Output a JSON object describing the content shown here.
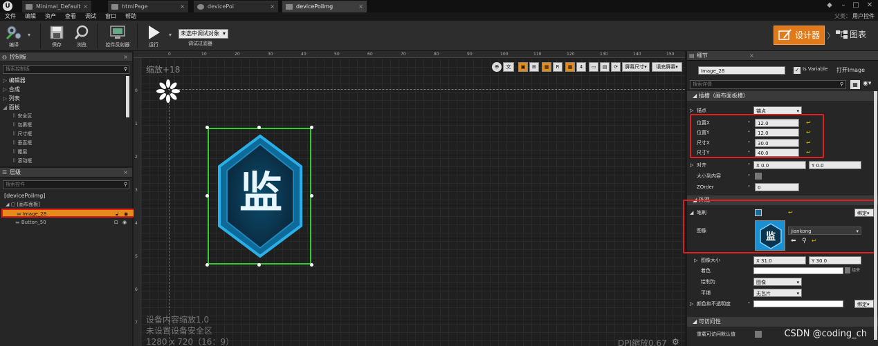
{
  "tabs": [
    {
      "label": "Minimal_Default"
    },
    {
      "label": "htmlPage"
    },
    {
      "label": "devicePoi"
    },
    {
      "label": "devicePoiImg"
    }
  ],
  "menu": {
    "items": [
      "文件",
      "编辑",
      "资产",
      "查看",
      "调试",
      "窗口",
      "帮助"
    ],
    "right": [
      "父类：",
      "用户控件"
    ]
  },
  "toolbar": {
    "compile": "编译",
    "save": "保存",
    "browse": "浏览",
    "widget_reflector": "控件反射器",
    "run": "运行",
    "debug_object": "未选中调试对象",
    "debug_filter": "调试过滤器",
    "designer": "设计器",
    "graph": "图表"
  },
  "palette": {
    "title": "控制板",
    "search_placeholder": "搜索控制板",
    "items": [
      {
        "label": "编辑器",
        "sub": false
      },
      {
        "label": "合成",
        "sub": false
      },
      {
        "label": "列表",
        "sub": false
      },
      {
        "label": "面板",
        "sub": false
      },
      {
        "label": "安全区",
        "sub": true
      },
      {
        "label": "包裹框",
        "sub": true
      },
      {
        "label": "尺寸框",
        "sub": true
      },
      {
        "label": "垂直框",
        "sub": true
      },
      {
        "label": "覆层",
        "sub": true
      },
      {
        "label": "滚动框",
        "sub": true
      }
    ]
  },
  "hierarchy": {
    "title": "层级",
    "search_placeholder": "搜索控件",
    "root": "[devicePoiImg]",
    "canvas_panel": "[画布面板]",
    "children": [
      "Image_28",
      "Button_50"
    ]
  },
  "canvas": {
    "zoom": "缩放+18",
    "ruler_top": [
      "0",
      "10",
      "20",
      "30",
      "40",
      "50",
      "60",
      "70",
      "80",
      "90",
      "100",
      "110",
      "120",
      "130",
      "140",
      "150"
    ],
    "ruler_left": [
      "0",
      "1",
      "2",
      "3",
      "4",
      "5",
      "6",
      "7"
    ],
    "screen_size": "屏幕尺寸",
    "fill_screen": "填充屏幕",
    "scale_number": "4",
    "info_line1": "设备内容缩放1.0",
    "info_line2": "未设置设备安全区",
    "info_line3": "1280 x 720（16：9）",
    "dpi": "DPI缩放0.67",
    "image_glyph": "监"
  },
  "details": {
    "title": "细节",
    "name_value": "Image_28",
    "is_variable": "Is Variable",
    "open_image": "打开Image",
    "search_placeholder": "搜索详情",
    "slot_section": "插槽（画布面板槽）",
    "anchor_label": "锚点",
    "anchor_value": "锚点",
    "pos_x_label": "位置X",
    "pos_x": "12.0",
    "pos_y_label": "位置Y",
    "pos_y": "12.0",
    "size_x_label": "尺寸X",
    "size_x": "30.0",
    "size_y_label": "尺寸Y",
    "size_y": "40.0",
    "align_label": "对齐",
    "align_x": "X  0.0",
    "align_y": "Y  0.0",
    "size_to_content": "大小到内容",
    "zorder_label": "ZOrder",
    "zorder": "0",
    "appearance_section": "外观",
    "brush_label": "笔刷",
    "bind_label": "绑定",
    "image_label": "图像",
    "image_value": "jiankong",
    "image_size_label": "图像大小",
    "image_size_x": "X  31.0",
    "image_size_y": "Y  30.0",
    "tint_label": "着色",
    "tint_aside": "组来",
    "draw_as_label": "绘制为",
    "draw_as": "图像",
    "tiling_label": "平铺",
    "tiling": "无瓦片",
    "color_opacity_label": "颜色和不透明度",
    "accessibility_section": "可访问性",
    "override_access": "重载可访问默认值",
    "colors": {
      "accent": "#e38c1a",
      "highlight_box": "#e02020"
    }
  },
  "watermark": "CSDN @coding_ch"
}
